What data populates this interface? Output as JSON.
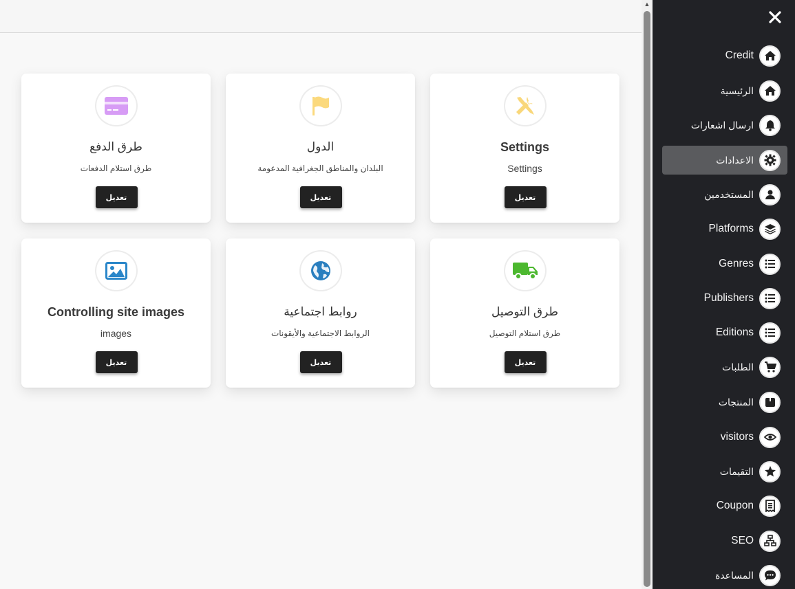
{
  "cards": [
    {
      "title": "Settings",
      "subtitle": "Settings",
      "button": "تعديل",
      "icon": "tools-icon",
      "icon_color": "#f9d77a"
    },
    {
      "title": "الدول",
      "subtitle": "البلدان والمناطق الجغرافية المدعومة",
      "button": "تعديل",
      "icon": "flag-icon",
      "icon_color": "#fbd97d"
    },
    {
      "title": "طرق الدفع",
      "subtitle": "طرق استلام الدفعات",
      "button": "تعديل",
      "icon": "credit-card-icon",
      "icon_color": "#d79cf5"
    },
    {
      "title": "طرق التوصيل",
      "subtitle": "طرق استلام التوصيل",
      "button": "تعديل",
      "icon": "truck-icon",
      "icon_color": "#4cb82f"
    },
    {
      "title": "روابط اجتماعية",
      "subtitle": "الروابط الاجتماعية والأيقونات",
      "button": "تعديل",
      "icon": "globe-icon",
      "icon_color": "#2a7fbf"
    },
    {
      "title": "Controlling site images",
      "subtitle": "images",
      "button": "تعديل",
      "icon": "image-icon",
      "icon_color": "#2a86c9"
    }
  ],
  "sidebar": {
    "close_icon": "close-icon",
    "active_index": 3,
    "items": [
      {
        "label": "Credit",
        "icon": "home-icon"
      },
      {
        "label": "الرئيسية",
        "icon": "home-icon"
      },
      {
        "label": "ارسال اشعارات",
        "icon": "bell-icon"
      },
      {
        "label": "الاعدادات",
        "icon": "gear-icon"
      },
      {
        "label": "المستخدمين",
        "icon": "user-icon"
      },
      {
        "label": "Platforms",
        "icon": "layers-icon"
      },
      {
        "label": "Genres",
        "icon": "list-icon"
      },
      {
        "label": "Publishers",
        "icon": "list-icon"
      },
      {
        "label": "Editions",
        "icon": "list-icon"
      },
      {
        "label": "الطلبات",
        "icon": "cart-icon"
      },
      {
        "label": "المنتجات",
        "icon": "box-icon"
      },
      {
        "label": "visitors",
        "icon": "eye-icon"
      },
      {
        "label": "التقيمات",
        "icon": "star-icon"
      },
      {
        "label": "Coupon",
        "icon": "receipt-icon"
      },
      {
        "label": "SEO",
        "icon": "sitemap-icon"
      },
      {
        "label": "المساعدة",
        "icon": "chat-icon"
      }
    ]
  },
  "colors": {
    "sidebar_bg": "#212226",
    "active_bg": "#5a5b5e",
    "button_bg": "#222222"
  }
}
